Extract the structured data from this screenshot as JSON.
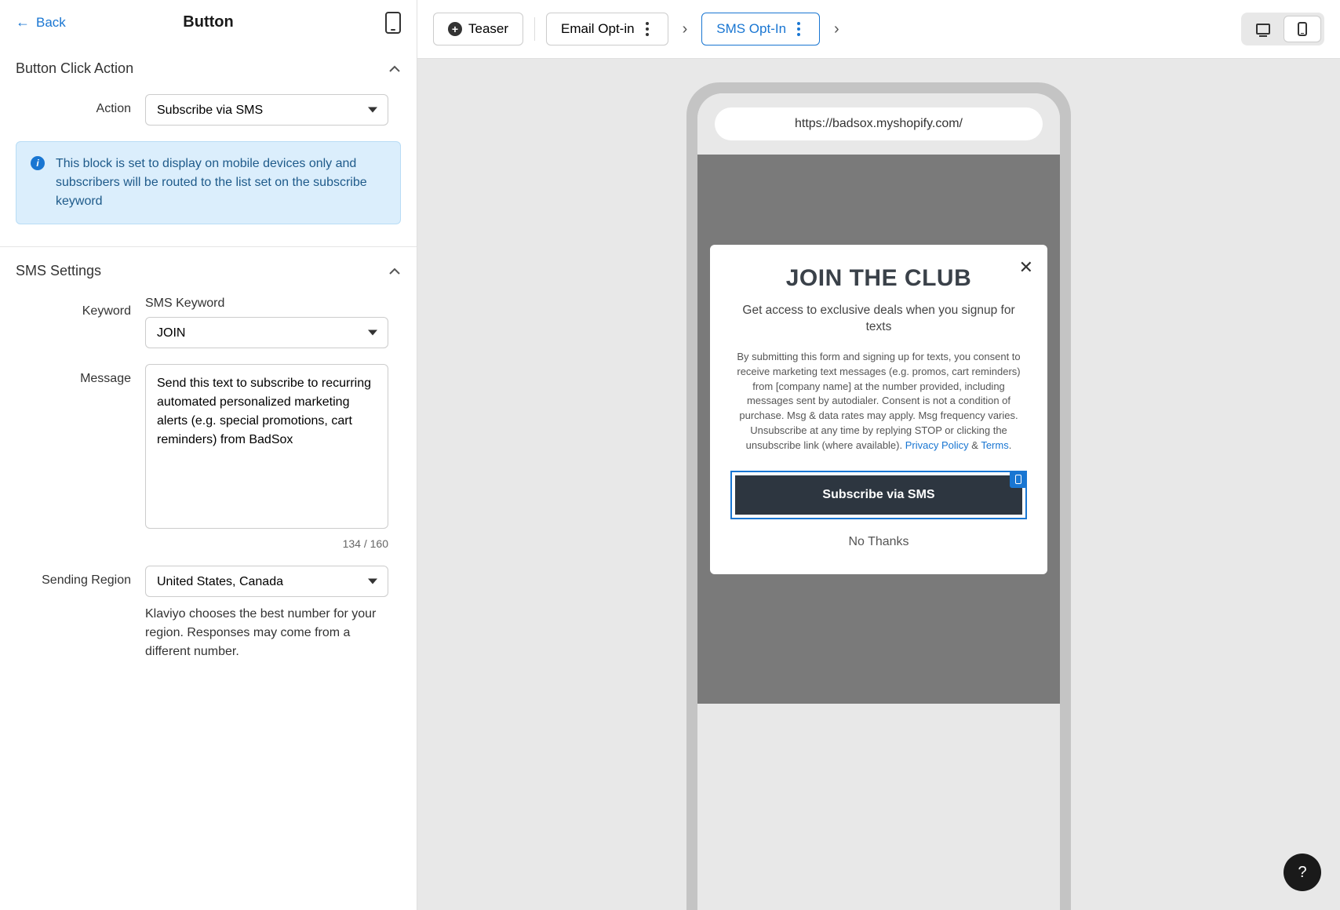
{
  "header": {
    "back_label": "Back",
    "title": "Button"
  },
  "sections": {
    "button_click_action": {
      "title": "Button Click Action",
      "action_label": "Action",
      "action_value": "Subscribe via SMS",
      "info_text": "This block is set to display on mobile devices only and subscribers will be routed to the list set on the subscribe keyword"
    },
    "sms_settings": {
      "title": "SMS Settings",
      "keyword_label": "Keyword",
      "keyword_sublabel": "SMS Keyword",
      "keyword_value": "JOIN",
      "message_label": "Message",
      "message_value": "Send this text to subscribe to recurring automated personalized marketing alerts (e.g. special promotions, cart reminders) from BadSox",
      "char_count": "134 / 160",
      "region_label": "Sending Region",
      "region_value": "United States, Canada",
      "region_helper": "Klaviyo chooses the best number for your region. Responses may come from a different number."
    }
  },
  "toolbar": {
    "teaser": "Teaser",
    "email_optin": "Email Opt-in",
    "sms_optin": "SMS Opt-In"
  },
  "preview": {
    "url": "https://badsox.myshopify.com/",
    "popup": {
      "title": "JOIN THE CLUB",
      "subtitle": "Get access to exclusive deals when you signup for texts",
      "legal_prefix": "By submitting this form and signing up for texts, you consent to receive marketing text messages (e.g. promos, cart reminders) from [company name] at the number provided, including messages sent by autodialer. Consent is not a condition of purchase. Msg & data rates may apply. Msg frequency varies. Unsubscribe at any time by replying STOP or clicking the unsubscribe link (where available). ",
      "privacy": "Privacy Policy",
      "amp": " & ",
      "terms": "Terms",
      "period": ".",
      "cta": "Subscribe via SMS",
      "decline": "No Thanks"
    }
  },
  "help": "?"
}
